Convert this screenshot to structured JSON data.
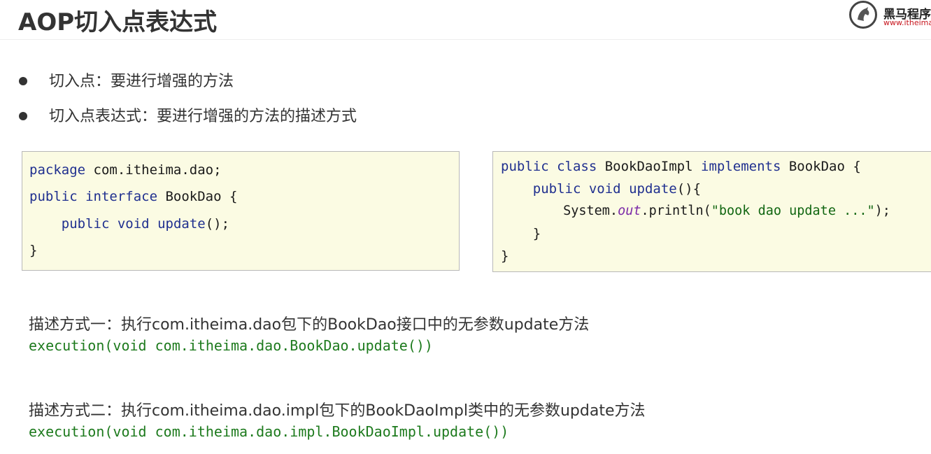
{
  "header": {
    "title": "AOP切入点表达式",
    "logo_text": "黑马程序",
    "logo_url": "www.itheima"
  },
  "bullets": [
    "切入点：要进行增强的方法",
    "切入点表达式：要进行增强的方法的描述方式"
  ],
  "code_left": {
    "line1": {
      "kw": "package",
      "rest": " com.itheima.dao;"
    },
    "line2": {
      "kw": "public interface",
      "rest": " BookDao {"
    },
    "line3": {
      "indent": "    ",
      "kw1": "public",
      "sp": " ",
      "kw2": "void",
      "sp2": " ",
      "method": "update",
      "rest": "();"
    },
    "line4": "}"
  },
  "code_right": {
    "line1": {
      "kw1": "public class",
      "mid": " BookDaoImpl ",
      "kw2": "implements",
      "rest": " BookDao {"
    },
    "line2": {
      "indent": "    ",
      "kw1": "public",
      "sp": " ",
      "kw2": "void",
      "sp2": " ",
      "method": "update",
      "rest": "(){"
    },
    "line3": {
      "indent": "        ",
      "pre": "System.",
      "field": "out",
      "mid": ".println(",
      "str": "\"book dao update ...\"",
      "rest": ");"
    },
    "line4": "    }",
    "line5": "}"
  },
  "descriptions": [
    {
      "text": "描述方式一：执行com.itheima.dao包下的BookDao接口中的无参数update方法",
      "expr": "execution(void com.itheima.dao.BookDao.update())"
    },
    {
      "text": "描述方式二：执行com.itheima.dao.impl包下的BookDaoImpl类中的无参数update方法",
      "expr": "execution(void com.itheima.dao.impl.BookDaoImpl.update())"
    }
  ]
}
